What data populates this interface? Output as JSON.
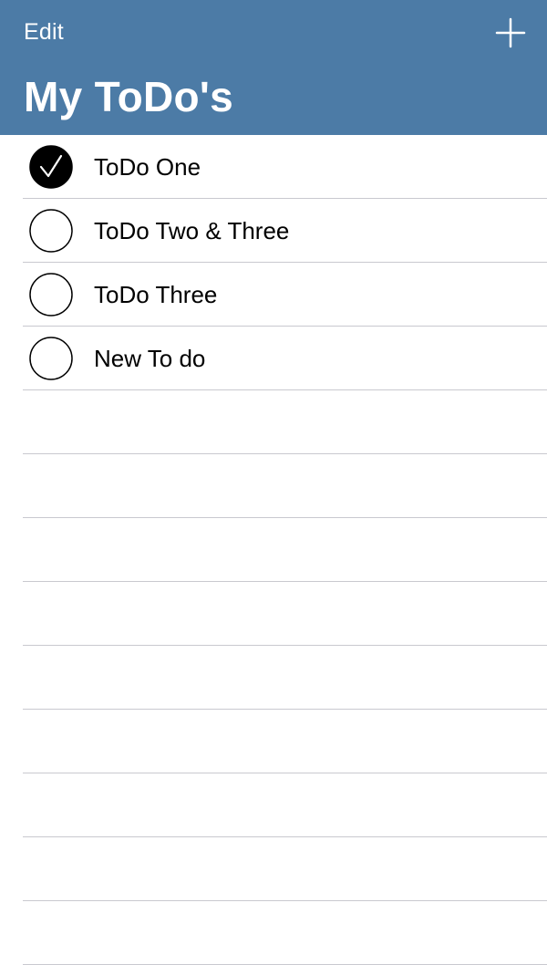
{
  "navbar": {
    "edit_label": "Edit",
    "add_icon": "plus-icon",
    "title": "My ToDo's",
    "background_color": "#4c7ba6",
    "text_color": "#ffffff"
  },
  "todos": [
    {
      "label": "ToDo One",
      "completed": true
    },
    {
      "label": "ToDo Two & Three",
      "completed": false
    },
    {
      "label": "ToDo Three",
      "completed": false
    },
    {
      "label": "New To do",
      "completed": false
    }
  ],
  "icons": {
    "checked": "checkmark-circle-filled-icon",
    "unchecked": "circle-outline-icon"
  },
  "colors": {
    "separator": "#c9c9cf",
    "text": "#000000",
    "check_fill": "#000000"
  }
}
